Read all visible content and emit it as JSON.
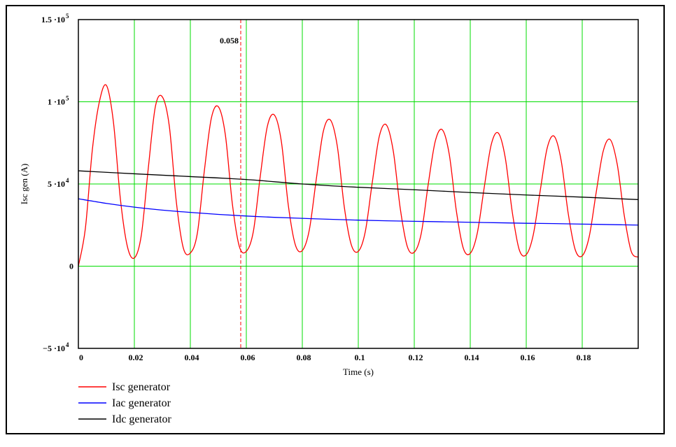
{
  "chart_data": {
    "type": "line",
    "xlabel": "Time (s)",
    "ylabel": "Isc gen (A)",
    "xlim": [
      0,
      0.2
    ],
    "ylim": [
      -50000,
      150000
    ],
    "grid": true,
    "grid_color": "#00dd00",
    "x_ticks": [
      0,
      0.02,
      0.04,
      0.06,
      0.08,
      0.1,
      0.12,
      0.14,
      0.16,
      0.18
    ],
    "x_tick_labels": [
      "0",
      "0.02",
      "0.04",
      "0.06",
      "0.08",
      "0.1",
      "0.12",
      "0.14",
      "0.16",
      "0.18"
    ],
    "y_ticks": [
      {
        "value": 150000,
        "mant": "1.5",
        "exp": "5"
      },
      {
        "value": 100000,
        "mant": "1",
        "exp": "5"
      },
      {
        "value": 50000,
        "mant": "5",
        "exp": "4"
      },
      {
        "value": 0,
        "mant": "0",
        "exp": ""
      },
      {
        "value": -50000,
        "mant": "−5",
        "exp": "4"
      }
    ],
    "marker": {
      "x": 0.058,
      "label": "0.058",
      "color": "#ff0000"
    },
    "legend_position": "bottom-left",
    "series": [
      {
        "name": "Isc generator",
        "color": "#ff0000",
        "x": [
          0,
          0.0025,
          0.005,
          0.0075,
          0.01,
          0.0125,
          0.015,
          0.0175,
          0.02,
          0.0225,
          0.025,
          0.0275,
          0.03,
          0.0325,
          0.035,
          0.0375,
          0.04,
          0.0425,
          0.045,
          0.0475,
          0.05,
          0.0525,
          0.055,
          0.0575,
          0.06,
          0.0625,
          0.065,
          0.0675,
          0.07,
          0.0725,
          0.075,
          0.0775,
          0.08,
          0.0825,
          0.085,
          0.0875,
          0.09,
          0.0925,
          0.095,
          0.0975,
          0.1,
          0.1025,
          0.105,
          0.1075,
          0.11,
          0.1125,
          0.115,
          0.1175,
          0.12,
          0.1225,
          0.125,
          0.1275,
          0.13,
          0.1325,
          0.135,
          0.1375,
          0.14,
          0.1425,
          0.145,
          0.1475,
          0.15,
          0.1525,
          0.155,
          0.1575,
          0.16,
          0.1625,
          0.165,
          0.1675,
          0.17,
          0.1725,
          0.175,
          0.1775,
          0.18,
          0.1825,
          0.185,
          0.1875,
          0.19,
          0.1925,
          0.195,
          0.1975,
          0.2
        ],
        "values": [
          0,
          23000,
          71000,
          100000,
          110000,
          88000,
          41000,
          12000,
          5000,
          19000,
          60000,
          97000,
          103000,
          85000,
          39000,
          11000,
          8000,
          20000,
          58000,
          90000,
          97000,
          80000,
          38000,
          12000,
          9000,
          21000,
          55000,
          85000,
          92000,
          76000,
          37000,
          13000,
          9500,
          22000,
          53000,
          82000,
          89000,
          73000,
          36000,
          13000,
          9000,
          21000,
          51000,
          79000,
          86000,
          70000,
          35000,
          12000,
          8500,
          20000,
          50000,
          76000,
          83000,
          68000,
          34000,
          11000,
          7800,
          20000,
          48000,
          74000,
          81000,
          66000,
          33000,
          10000,
          7000,
          19000,
          46000,
          72000,
          79000,
          64000,
          32000,
          10000,
          6300,
          18000,
          45000,
          70000,
          77000,
          62000,
          31000,
          9000,
          5500
        ]
      },
      {
        "name": "Iac generator",
        "color": "#0000ff",
        "x": [
          0,
          0.01,
          0.02,
          0.03,
          0.04,
          0.05,
          0.06,
          0.07,
          0.08,
          0.09,
          0.1,
          0.11,
          0.12,
          0.13,
          0.14,
          0.15,
          0.16,
          0.17,
          0.18,
          0.19,
          0.2
        ],
        "values": [
          41000,
          38200,
          35900,
          34100,
          32700,
          31500,
          30500,
          29700,
          29100,
          28500,
          28000,
          27600,
          27300,
          27000,
          26700,
          26400,
          26100,
          25900,
          25600,
          25300,
          25000
        ]
      },
      {
        "name": "Idc generator",
        "color": "#000000",
        "x": [
          0,
          0.02,
          0.04,
          0.06,
          0.08,
          0.1,
          0.12,
          0.14,
          0.16,
          0.18,
          0.2
        ],
        "values": [
          58000,
          56200,
          54500,
          52700,
          50000,
          48000,
          46500,
          44800,
          43300,
          42000,
          40500
        ]
      }
    ]
  }
}
